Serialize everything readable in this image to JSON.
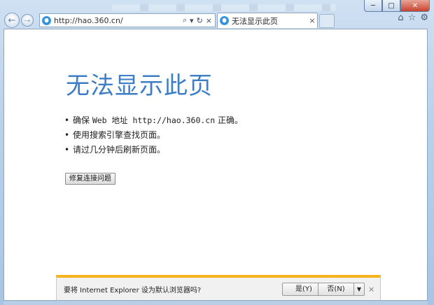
{
  "window": {
    "caption_buttons": {
      "minimize": "─",
      "maximize": "□",
      "close": "✕"
    }
  },
  "toolbar": {
    "back_icon": "back-arrow-icon",
    "back_glyph": "←",
    "forward_glyph": "→",
    "address_url": "http://hao.360.cn/",
    "search_glyph": "⌕",
    "dropdown_glyph": "▾",
    "refresh_glyph": "↻",
    "close_glyph": "×"
  },
  "tab": {
    "title": "无法显示此页",
    "close_glyph": "×"
  },
  "right_icons": {
    "home": "⌂",
    "favorites": "☆",
    "settings": "⚙"
  },
  "page": {
    "title": "无法显示此页",
    "bullets": [
      {
        "prefix": "确保 ",
        "mono_part": "Web 地址 http://hao.360.cn",
        "suffix": " 正确。"
      },
      {
        "text": "使用搜索引擎查找页面。"
      },
      {
        "text": "请过几分钟后刷新页面。"
      }
    ],
    "fix_button": "修复连接问题"
  },
  "notification": {
    "message": "要将 Internet Explorer 设为默认浏览器吗?",
    "yes_label": "是(Y)",
    "no_label": "否(N)",
    "dropdown_glyph": "▼",
    "dismiss_glyph": "×"
  },
  "colors": {
    "accent_title": "#3d7ec7",
    "notification_bar": "#f6b31c",
    "chrome": "#b9d1ea"
  }
}
